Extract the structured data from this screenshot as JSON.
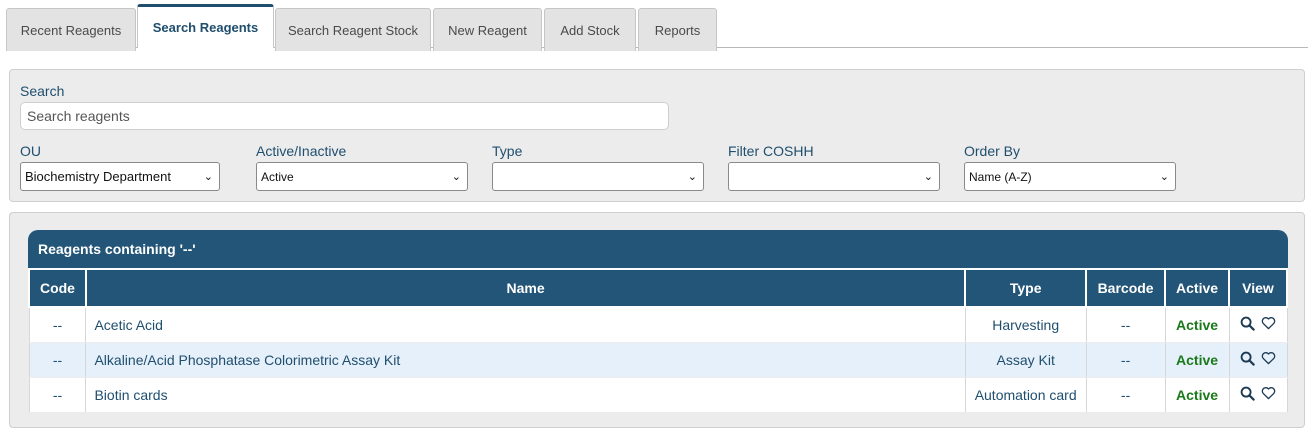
{
  "tabs": [
    {
      "label": "Recent Reagents",
      "active": false
    },
    {
      "label": "Search Reagents",
      "active": true
    },
    {
      "label": "Search Reagent Stock",
      "active": false
    },
    {
      "label": "New Reagent",
      "active": false
    },
    {
      "label": "Add Stock",
      "active": false
    },
    {
      "label": "Reports",
      "active": false
    }
  ],
  "search": {
    "label": "Search",
    "placeholder": "Search reagents",
    "value": ""
  },
  "filters": {
    "ou": {
      "label": "OU",
      "value": "Biochemistry Department"
    },
    "active": {
      "label": "Active/Inactive",
      "value": "Active"
    },
    "type": {
      "label": "Type",
      "value": ""
    },
    "coshh": {
      "label": "Filter COSHH",
      "value": ""
    },
    "order": {
      "label": "Order By",
      "value": "Name (A-Z)"
    }
  },
  "results": {
    "title": "Reagents containing '--'",
    "columns": [
      "Code",
      "Name",
      "Type",
      "Barcode",
      "Active",
      "View"
    ],
    "rows": [
      {
        "code": "--",
        "name": "Acetic Acid",
        "type": "Harvesting",
        "barcode": "--",
        "active": "Active"
      },
      {
        "code": "--",
        "name": "Alkaline/Acid Phosphatase Colorimetric Assay Kit",
        "type": "Assay Kit",
        "barcode": "--",
        "active": "Active"
      },
      {
        "code": "--",
        "name": "Biotin cards",
        "type": "Automation card",
        "barcode": "--",
        "active": "Active"
      }
    ]
  },
  "icons": {
    "view": "search-icon",
    "favourite": "heart-icon"
  },
  "colors": {
    "header": "#225577",
    "active_text": "#1a7a1a",
    "link": "#1f4e6e",
    "alt_row": "#e6f0fa"
  }
}
